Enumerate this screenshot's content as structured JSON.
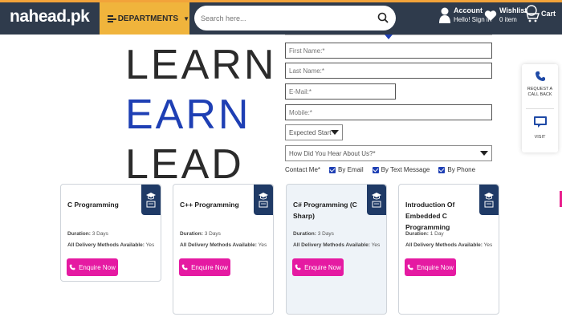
{
  "header": {
    "logo_text": "nahead.pk",
    "departments_label": "DEPARTMENTS",
    "search_placeholder": "Search here...",
    "account_label": "Account",
    "account_sub": "Hello! Sign in",
    "wishlist_label": "Wishlist",
    "wishlist_sub": "0 item",
    "cart_label": "Cart",
    "colors": {
      "bar": "#2f3b4c",
      "accent": "#f0b43c"
    }
  },
  "hero": {
    "line1": "LEARN",
    "line2": "EARN",
    "line3": "LEAD"
  },
  "form": {
    "first_name_placeholder": "First Name:*",
    "last_name_placeholder": "Last Name:*",
    "email_placeholder": "E-Mail:*",
    "mobile_placeholder": "Mobile:*",
    "start_select_value": "Expected Start Y",
    "heard_select_value": "How Did You Hear About Us?*",
    "contact_label": "Contact Me*",
    "contact_options": [
      {
        "label": "By Email",
        "checked": true
      },
      {
        "label": "By Text Message",
        "checked": true
      },
      {
        "label": "By Phone",
        "checked": true
      }
    ]
  },
  "side_widget": {
    "request_label": "REQUEST A CALL BACK",
    "visit_label": "VISIT"
  },
  "courses": [
    {
      "title": "C Programming",
      "duration_label": "Duration:",
      "duration": "3 Days",
      "delivery_label": "All Delivery Methods Available:",
      "delivery": "Yes",
      "button": "Enquire Now"
    },
    {
      "title": "C++ Programming",
      "duration_label": "Duration:",
      "duration": "3 Days",
      "delivery_label": "All Delivery Methods Available:",
      "delivery": "Yes",
      "button": "Enquire Now"
    },
    {
      "title": "C# Programming (C Sharp)",
      "duration_label": "Duration:",
      "duration": "3 Days",
      "delivery_label": "All Delivery Methods Available:",
      "delivery": "Yes",
      "button": "Enquire Now"
    },
    {
      "title": "Introduction Of Embedded C Programming",
      "duration_label": "Duration:",
      "duration": "1 Day",
      "delivery_label": "All Delivery Methods Available:",
      "delivery": "Yes",
      "button": "Enquire Now"
    }
  ],
  "colors": {
    "brand_blue": "#1e3fb4",
    "enquire_pink": "#e51aa2",
    "badge_navy": "#1f3a66"
  }
}
